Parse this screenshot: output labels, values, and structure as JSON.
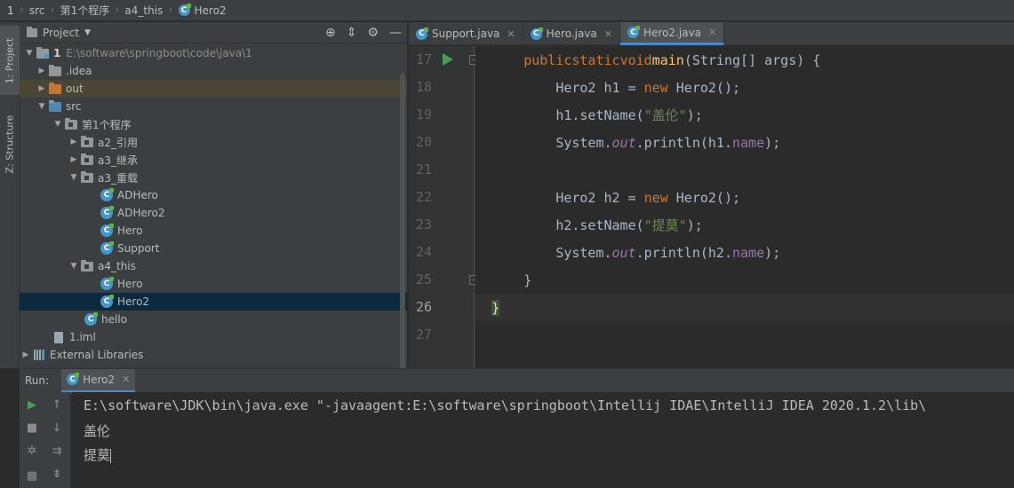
{
  "breadcrumb": [
    "1",
    "src",
    "第1个程序",
    "a4_this",
    "Hero2"
  ],
  "sidebar_tabs": {
    "project": "1: Project",
    "structure": "Z: Structure"
  },
  "project_panel": {
    "title": "Project",
    "tree": [
      {
        "label": "1",
        "path": "E:\\software\\springboot\\code\\java\\1",
        "icon": "folder-icon",
        "arrow": "▼"
      },
      {
        "label": ".idea",
        "icon": "folder-icon",
        "arrow": "▶"
      },
      {
        "label": "out",
        "icon": "folder-orange-icon",
        "arrow": "▶"
      },
      {
        "label": "src",
        "icon": "folder-icon",
        "arrow": "▼"
      },
      {
        "label": "第1个程序",
        "icon": "package-icon",
        "arrow": "▼"
      },
      {
        "label": "a2_引用",
        "icon": "package-icon",
        "arrow": "▶"
      },
      {
        "label": "a3_继承",
        "icon": "package-icon",
        "arrow": "▶"
      },
      {
        "label": "a3_重载",
        "icon": "package-icon",
        "arrow": "▼"
      },
      {
        "label": "ADHero",
        "icon": "class-icon"
      },
      {
        "label": "ADHero2",
        "icon": "class-icon"
      },
      {
        "label": "Hero",
        "icon": "class-icon"
      },
      {
        "label": "Support",
        "icon": "class-icon"
      },
      {
        "label": "a4_this",
        "icon": "package-icon",
        "arrow": "▼"
      },
      {
        "label": "Hero",
        "icon": "class-icon"
      },
      {
        "label": "Hero2",
        "icon": "class-icon"
      },
      {
        "label": "hello",
        "icon": "class-icon"
      },
      {
        "label": "1.iml",
        "icon": "iml-file-icon"
      },
      {
        "label": "External Libraries",
        "icon": "libraries-icon",
        "arrow": "▶"
      }
    ]
  },
  "editor": {
    "tabs": [
      "Support.java",
      "Hero.java",
      "Hero2.java"
    ],
    "active_tab": "Hero2.java",
    "line_numbers": [
      "17",
      "18",
      "19",
      "20",
      "21",
      "22",
      "23",
      "24",
      "25",
      "26",
      "27"
    ],
    "code": {
      "l17": {
        "a": "public",
        "b": "static",
        "c": "void",
        "d": "main",
        "e": "(String[] args) {"
      },
      "l18": {
        "a": "Hero2 h1 = ",
        "b": "new",
        "c": " Hero2();"
      },
      "l19": {
        "a": "h1.setName(",
        "b": "\"盖伦\"",
        "c": ");"
      },
      "l20": {
        "a": "System.",
        "b": "out",
        "c": ".println(h1.",
        "d": "name",
        "e": ");"
      },
      "l22": {
        "a": "Hero2 h2 = ",
        "b": "new",
        "c": " Hero2();"
      },
      "l23": {
        "a": "h2.setName(",
        "b": "\"提莫\"",
        "c": ");"
      },
      "l24": {
        "a": "System.",
        "b": "out",
        "c": ".println(h2.",
        "d": "name",
        "e": ");"
      },
      "l25": "}",
      "l26": "}"
    }
  },
  "run_panel": {
    "label": "Run:",
    "tab": "Hero2",
    "console": [
      "E:\\software\\JDK\\bin\\java.exe \"-javaagent:E:\\software\\springboot\\Intellij IDAE\\IntelliJ IDEA 2020.1.2\\lib\\",
      "盖伦",
      "提莫"
    ]
  }
}
